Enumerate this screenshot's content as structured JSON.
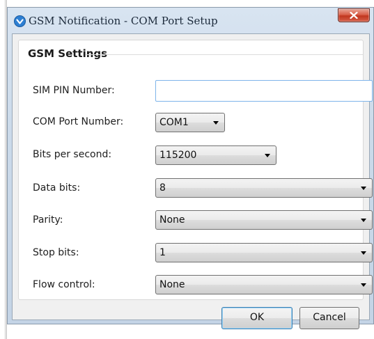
{
  "window": {
    "title": "GSM Notification - COM Port Setup"
  },
  "group": {
    "title": "GSM Settings"
  },
  "fields": {
    "sim_pin": {
      "label": "SIM PIN Number:",
      "value": ""
    },
    "com_port": {
      "label": "COM Port Number:",
      "value": "COM1"
    },
    "bits_per_second": {
      "label": "Bits per second:",
      "value": "115200"
    },
    "data_bits": {
      "label": "Data bits:",
      "value": "8"
    },
    "parity": {
      "label": "Parity:",
      "value": "None"
    },
    "stop_bits": {
      "label": "Stop bits:",
      "value": "1"
    },
    "flow_control": {
      "label": "Flow control:",
      "value": "None"
    }
  },
  "buttons": {
    "ok_label": "OK",
    "cancel_label": "Cancel"
  },
  "colors": {
    "close_button": "#c1361e",
    "focus_border": "#3c7fb1",
    "titlebar": "#cbdaea"
  },
  "icons": {
    "app": "checkmark-shield-icon",
    "close": "close-icon",
    "dropdown": "chevron-down-icon"
  }
}
